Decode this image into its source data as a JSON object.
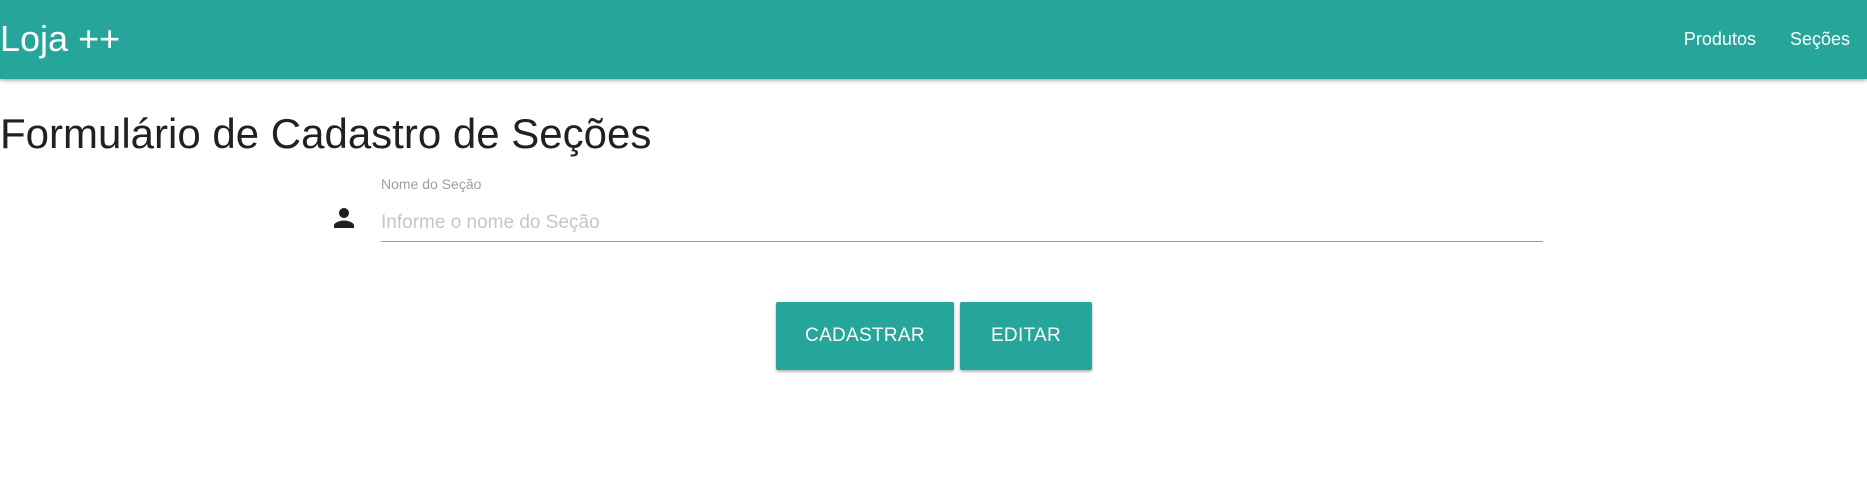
{
  "navbar": {
    "brand": "Loja ++",
    "links": [
      {
        "label": "Produtos"
      },
      {
        "label": "Seções"
      }
    ],
    "color": "#26a69a"
  },
  "page": {
    "title": "Formulário de Cadastro de Seções"
  },
  "form": {
    "name_field": {
      "label": "Nome do Seção",
      "placeholder": "Informe o nome do Seção",
      "value": "",
      "icon": "person-icon"
    },
    "buttons": {
      "submit_label": "CADASTRAR",
      "edit_label": "EDITAR"
    }
  }
}
